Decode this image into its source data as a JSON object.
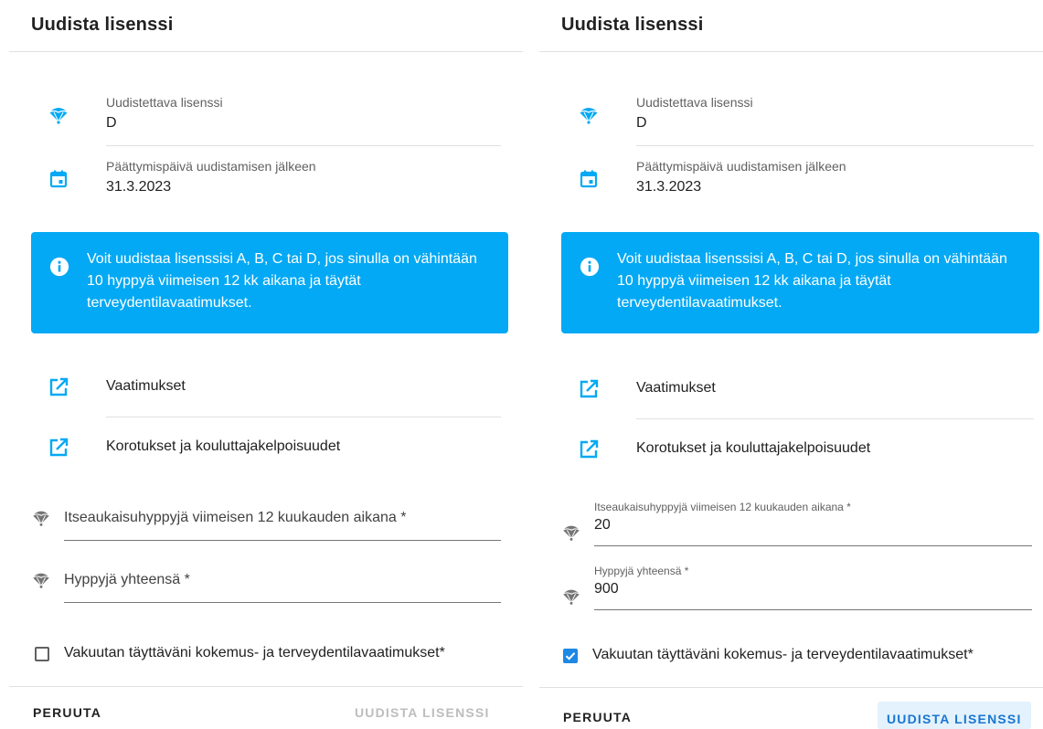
{
  "colors": {
    "accent": "#1e88e5",
    "alert_bg": "#03a9f4",
    "divider": "#e0e0e0"
  },
  "left_dialog": {
    "title": "Uudista lisenssi",
    "license": {
      "label": "Uudistettava lisenssi",
      "value": "D",
      "icon": "parachute-icon"
    },
    "expiry": {
      "label": "Päättymispäivä uudistamisen jälkeen",
      "value": "31.3.2023",
      "icon": "calendar-icon"
    },
    "info_alert": {
      "icon": "info-icon",
      "text": "Voit uudistaa lisenssisi A, B, C tai D, jos sinulla on vähintään 10 hyppyä viimeisen 12 kk aikana ja täytät terveydentilavaatimukset."
    },
    "links": [
      {
        "label": "Vaatimukset",
        "icon": "open-in-new-icon"
      },
      {
        "label": "Korotukset ja kouluttajakelpoisuudet",
        "icon": "open-in-new-icon"
      }
    ],
    "fields": [
      {
        "placeholder": "Itseaukaisuhyppyjä viimeisen 12 kuukauden aikana *",
        "value": "",
        "icon": "parachute-icon"
      },
      {
        "placeholder": "Hyppyjä yhteensä *",
        "value": "",
        "icon": "parachute-icon"
      }
    ],
    "checkbox": {
      "label": "Vakuutan täyttäväni kokemus- ja terveydentilavaatimukset*",
      "checked": false
    },
    "cancel_label": "PERUUTA",
    "submit_label": "UUDISTA LISENSSI",
    "submit_enabled": false
  },
  "right_dialog": {
    "title": "Uudista lisenssi",
    "license": {
      "label": "Uudistettava lisenssi",
      "value": "D",
      "icon": "parachute-icon"
    },
    "expiry": {
      "label": "Päättymispäivä uudistamisen jälkeen",
      "value": "31.3.2023",
      "icon": "calendar-icon"
    },
    "info_alert": {
      "icon": "info-icon",
      "text": "Voit uudistaa lisenssisi A, B, C tai D, jos sinulla on vähintään 10 hyppyä viimeisen 12 kk aikana ja täytät terveydentilavaatimukset."
    },
    "links": [
      {
        "label": "Vaatimukset",
        "icon": "open-in-new-icon"
      },
      {
        "label": "Korotukset ja kouluttajakelpoisuudet",
        "icon": "open-in-new-icon"
      }
    ],
    "fields": [
      {
        "label": "Itseaukaisuhyppyjä viimeisen 12 kuukauden aikana *",
        "value": "20",
        "icon": "parachute-icon"
      },
      {
        "label": "Hyppyjä yhteensä *",
        "value": "900",
        "icon": "parachute-icon"
      }
    ],
    "checkbox": {
      "label": "Vakuutan täyttäväni kokemus- ja terveydentilavaatimukset*",
      "checked": true
    },
    "cancel_label": "PERUUTA",
    "submit_label": "UUDISTA LISENSSI",
    "submit_enabled": true
  }
}
